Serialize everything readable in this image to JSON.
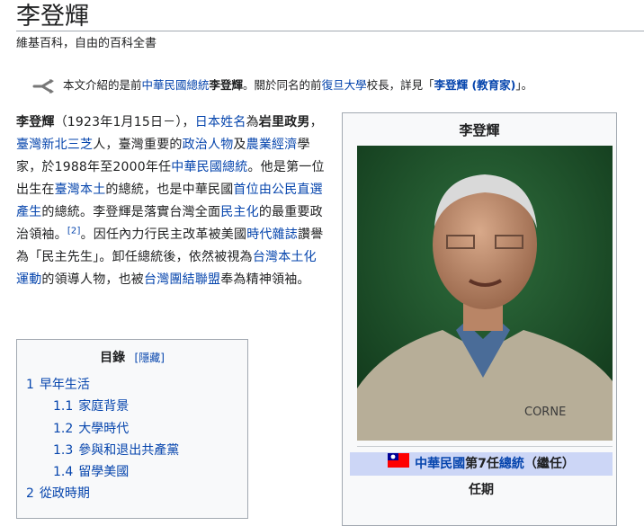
{
  "page": {
    "title": "李登輝",
    "site_subtitle": "維基百科，自由的百科全書"
  },
  "hatnote": {
    "icon": "disambiguation-icon",
    "pre": "本文介紹的是前",
    "link1": "中華民國總統",
    "bold_name": "李登輝",
    "mid1": "。關於同名的前",
    "link2": "復旦大學",
    "mid2": "校長，詳見「",
    "link3": "李登輝 (教育家)",
    "post": "」。"
  },
  "lead": {
    "name": "李登輝",
    "t1": "（1923年1月15日－），",
    "l_japanese_name": "日本姓名",
    "t2": "為",
    "japanese_name": "岩里政男",
    "t3": "，",
    "l_sanzhi": "臺灣新北三芝",
    "t4": "人，臺灣重要的",
    "l_politician": "政治人物",
    "t5": "及",
    "l_agri_econ": "農業經濟",
    "t6": "學家，於1988年至2000年任",
    "l_president": "中華民國總統",
    "t7": "。他是第一位出生在",
    "l_taiwan_local": "臺灣本土",
    "t8": "的總統，也是中華民國",
    "l_direct_election": "首位由公民直選產生",
    "t9": "的總統。李登輝是落實台灣全面",
    "l_democratization": "民主化",
    "t10": "的最重要政治領袖。",
    "ref": "[2]",
    "t11": "。因任內力行民主改革被美國",
    "l_time": "時代雜誌",
    "t12": "讚譽為「民主先生」。卸任總統後，依然被視為",
    "l_localization": "台灣本土化運動",
    "t13": "的領導人物，也被",
    "l_tsu": "台灣團結聯盟",
    "t14": "奉為精神領袖。"
  },
  "toc": {
    "title": "目錄",
    "hide_label": "[隱藏]",
    "items": [
      {
        "num": "1",
        "label": "早年生活"
      },
      {
        "num": "1.1",
        "label": "家庭背景"
      },
      {
        "num": "1.2",
        "label": "大學時代"
      },
      {
        "num": "1.3",
        "label": "參與和退出共產黨"
      },
      {
        "num": "1.4",
        "label": "留學美國"
      },
      {
        "num": "2",
        "label": "從政時期"
      }
    ]
  },
  "infobox": {
    "title": "李登輝",
    "portrait_text": "CORNE",
    "office_country": "中華民國",
    "office_mid": "第7任",
    "office_role": "總統",
    "office_suffix": "（繼任）",
    "term_label": "任期"
  },
  "colors": {
    "link": "#0645ad",
    "infobox_bg": "#f8f9fa",
    "office_band": "#ccd6f6",
    "border": "#a2a9b1"
  }
}
